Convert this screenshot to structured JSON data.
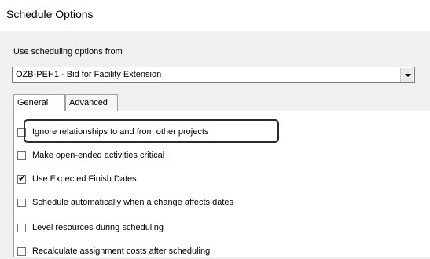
{
  "window": {
    "title": "Schedule Options"
  },
  "source": {
    "label": "Use scheduling options from",
    "selected": "OZB-PEH1 - Bid for Facility Extension"
  },
  "tabs": [
    {
      "label": "General",
      "active": true
    },
    {
      "label": "Advanced",
      "active": false
    }
  ],
  "options": [
    {
      "label": "Ignore relationships to and from other projects",
      "checked": false,
      "highlighted": true
    },
    {
      "label": "Make open-ended activities critical",
      "checked": false
    },
    {
      "label": "Use Expected Finish Dates",
      "checked": true
    },
    {
      "label": "Schedule automatically when a change affects dates",
      "checked": false
    },
    {
      "label": "Level resources during scheduling",
      "checked": false
    },
    {
      "label": "Recalculate assignment costs after scheduling",
      "checked": false
    }
  ],
  "colors": {
    "highlight_border": "#2b2b2b",
    "panel_bg": "#ffffff",
    "dialog_bg": "#f0f0f0"
  }
}
